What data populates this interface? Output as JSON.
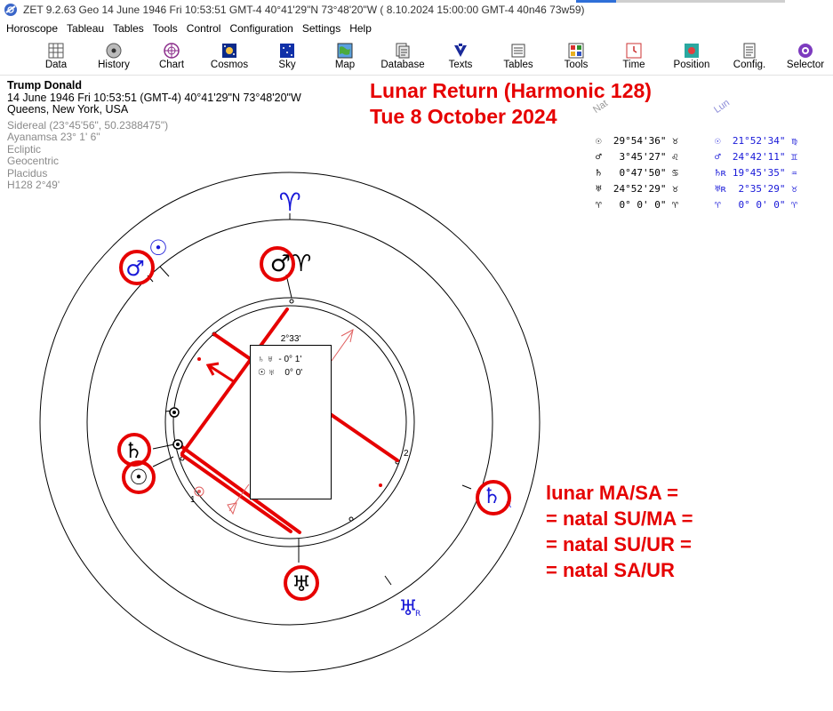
{
  "window": {
    "title": "ZET 9.2.63 Geo   14 June 1946  Fri  10:53:51 GMT-4 40°41'29\"N  73°48'20\"W  ( 8.10.2024  15:00:00 GMT-4 40n46 73w59)"
  },
  "menu": [
    "Horoscope",
    "Tableau",
    "Tables",
    "Tools",
    "Control",
    "Configuration",
    "Settings",
    "Help"
  ],
  "toolbar": [
    {
      "label": "Data",
      "icon": "data-grid-icon"
    },
    {
      "label": "History",
      "icon": "history-disc-icon"
    },
    {
      "label": "Chart",
      "icon": "chart-wheel-icon"
    },
    {
      "label": "Cosmos",
      "icon": "cosmos-icon"
    },
    {
      "label": "Sky",
      "icon": "sky-icon"
    },
    {
      "label": "Map",
      "icon": "map-icon"
    },
    {
      "label": "Database",
      "icon": "database-icon"
    },
    {
      "label": "Texts",
      "icon": "texts-icon"
    },
    {
      "label": "Tables",
      "icon": "tables-icon"
    },
    {
      "label": "Tools",
      "icon": "tools-icon"
    },
    {
      "label": "Time",
      "icon": "time-icon"
    },
    {
      "label": "Position",
      "icon": "position-icon"
    },
    {
      "label": "Config.",
      "icon": "config-icon"
    },
    {
      "label": "Selector",
      "icon": "selector-icon"
    }
  ],
  "info": {
    "name": "Trump Donald",
    "line1": "14 June 1946  Fri  10:53:51 (GMT-4) 40°41'29\"N  73°48'20\"W",
    "line2": "Queens, New York, USA",
    "sidereal": "Sidereal (23°45'56\", 50.2388475\")",
    "ayanamsa": "Ayanamsa 23° 1' 6\"",
    "ecliptic": "Ecliptic",
    "geocentric": "Geocentric",
    "placidus": "Placidus",
    "harmonic": "H128   2°49'"
  },
  "headline": {
    "line1": "Lunar Return (Harmonic 128)",
    "line2": "Tue 8 October 2024"
  },
  "tables": {
    "nat_label": "Nat",
    "lun_label": "Lun",
    "nat": [
      {
        "glyph": "☉",
        "pos": "29°54'36\" ♉"
      },
      {
        "glyph": "♂",
        "pos": " 3°45'27\" ♌"
      },
      {
        "glyph": "♄",
        "pos": " 0°47'50\" ♋"
      },
      {
        "glyph": "♅",
        "pos": "24°52'29\" ♉"
      },
      {
        "glyph": "♈",
        "pos": " 0° 0' 0\" ♈"
      }
    ],
    "lun": [
      {
        "glyph": "☉",
        "pos": "21°52'34\" ♍"
      },
      {
        "glyph": "♂",
        "pos": "24°42'11\" ♊"
      },
      {
        "glyph": "♄ʀ",
        "pos": "19°45'35\" ♒"
      },
      {
        "glyph": "♅ʀ",
        "pos": " 2°35'29\" ♉"
      },
      {
        "glyph": "♈",
        "pos": " 0° 0' 0\" ♈"
      }
    ]
  },
  "wheel": {
    "aspect_box": {
      "title": "2°33'",
      "row1_planets": "♄ ♅",
      "row1_value": "- 0° 1'",
      "row2_planets": "☉ ♅",
      "row2_value": "0° 0'"
    },
    "house_labels": [
      "1",
      "2"
    ],
    "glyphs": {
      "aries_outer": "♈",
      "mars_aries": "♂♈",
      "mars_outer": "♂",
      "sun_outer": "☉",
      "saturn_inner": "♄",
      "sun_inner": "☉",
      "saturn_outer": "♄",
      "saturn_outer_r": "R",
      "uranus_inner": "♅",
      "uranus_outer": "♅",
      "uranus_outer_r": "R"
    },
    "colors": {
      "accent": "#e60000",
      "blue": "#1818d8"
    }
  },
  "annotation": {
    "line1": "lunar MA/SA =",
    "line2": "= natal SU/MA =",
    "line3": "= natal SU/UR =",
    "line4": "= natal SA/UR"
  }
}
